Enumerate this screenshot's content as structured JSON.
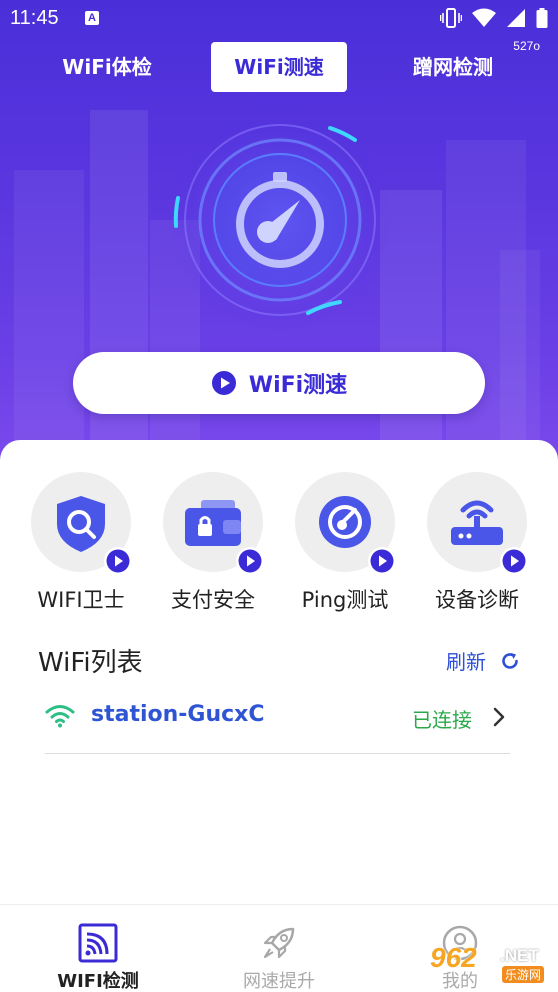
{
  "status_bar": {
    "time": "11:45",
    "notification_letter": "A"
  },
  "version_badge": "527o",
  "top_tabs": [
    {
      "label": "WiFi体检",
      "active": false
    },
    {
      "label": "WiFi测速",
      "active": true
    },
    {
      "label": "蹭网检测",
      "active": false
    }
  ],
  "speed_gauge": {
    "icon": "speedometer-icon"
  },
  "start_button": {
    "label": "WiFi测速",
    "icon": "play-circle-icon"
  },
  "tools": [
    {
      "label": "WIFI卫士",
      "icon": "shield-search-icon"
    },
    {
      "label": "支付安全",
      "icon": "wallet-lock-icon"
    },
    {
      "label": "Ping测试",
      "icon": "ping-gauge-icon"
    },
    {
      "label": "设备诊断",
      "icon": "router-icon"
    }
  ],
  "wifi_list": {
    "title": "WiFi列表",
    "refresh_label": "刷新",
    "networks": [
      {
        "ssid": "station-GucxC",
        "status": "已连接"
      }
    ]
  },
  "bottom_nav": [
    {
      "label": "WIFI检测",
      "icon": "cast-wifi-icon",
      "active": true
    },
    {
      "label": "网速提升",
      "icon": "rocket-icon",
      "active": false
    },
    {
      "label": "我的",
      "icon": "profile-icon",
      "active": false
    }
  ],
  "watermark": {
    "number": "962",
    "domain": ".NET",
    "site_name": "乐游网"
  },
  "colors": {
    "primary": "#3b2bd6",
    "hero_gradient_start": "#4a2fd8",
    "link_blue": "#2f4fd6",
    "connected_green": "#2ba84a",
    "tool_icon_blue": "#4a56e8"
  }
}
